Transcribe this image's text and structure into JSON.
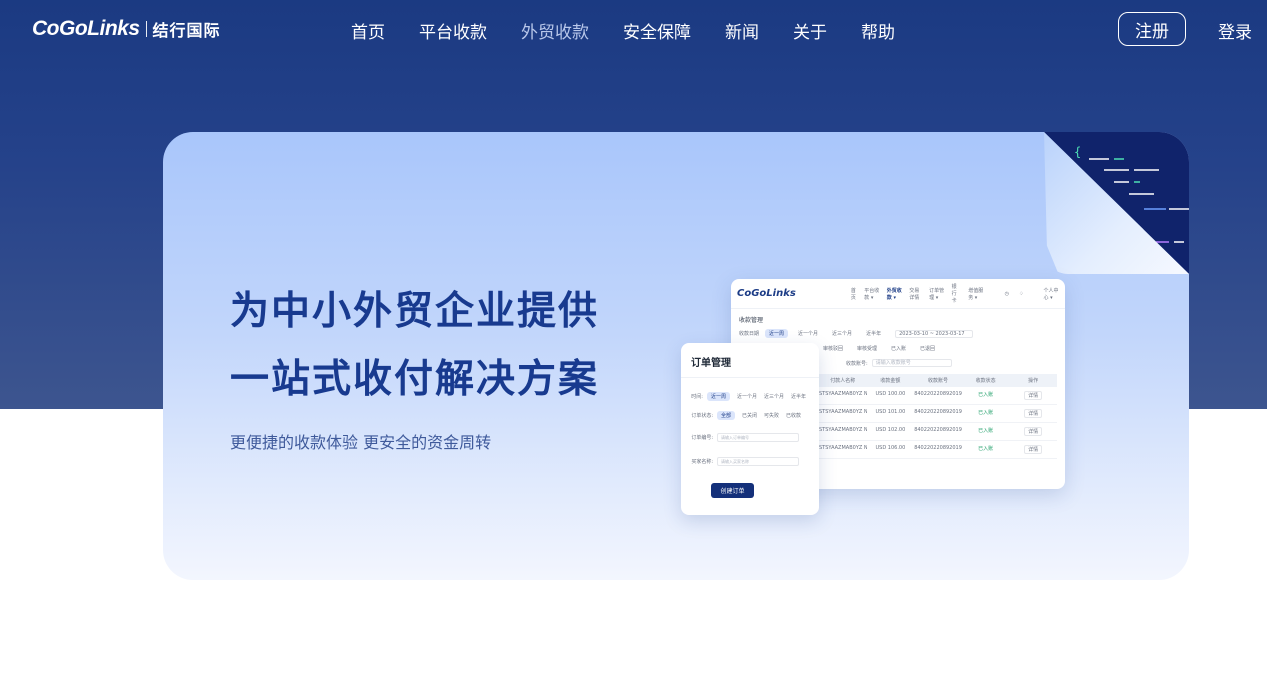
{
  "nav": {
    "logo_word": "CoGoLinks",
    "logo_cn": "结行国际",
    "items": [
      {
        "label": "首页"
      },
      {
        "label": "平台收款"
      },
      {
        "label": "外贸收款",
        "active": true
      },
      {
        "label": "安全保障"
      },
      {
        "label": "新闻"
      },
      {
        "label": "关于"
      },
      {
        "label": "帮助"
      }
    ],
    "register_label": "注册",
    "login_label": "登录"
  },
  "hero": {
    "title_line1": "为中小外贸企业提供",
    "title_line2": "一站式收付解决方案",
    "subtitle": "更便捷的收款体验 更安全的资金周转"
  },
  "dashboard_mock": {
    "logo": "CoGoLinks",
    "tabs": [
      "首页",
      "平台收款 ▾",
      "外贸收款 ▾",
      "交易详情",
      "订单管理 ▾",
      "银行卡",
      "增值服务 ▾"
    ],
    "active_tab_index": 2,
    "user": "个人中心 ▾",
    "page_title": "收款管理",
    "date_label": "收款日期",
    "date_chips": [
      "近一周",
      "近一个月",
      "近三个月",
      "近半年"
    ],
    "date_range": "2023-03-10 ~ 2023-03-17",
    "status_chips": [
      "审核驳回",
      "审核受理",
      "已入账",
      "已退回"
    ],
    "search_label": "收款账号:",
    "search_placeholder": "请输入收款账号",
    "columns": [
      "付款人名称",
      "收款金额",
      "收款账号",
      "收款状态",
      "操作"
    ],
    "rows": [
      {
        "payer": "STSYAAZMAB0YZ NAB",
        "amount": "USD 100.00",
        "account": "8402202208920191",
        "status": "已入账",
        "action": "详情"
      },
      {
        "payer": "STSYAAZMAB0YZ NAB",
        "amount": "USD 101.00",
        "account": "8402202208920191",
        "status": "已入账",
        "action": "详情"
      },
      {
        "payer": "STSYAAZMAB0YZ NAB",
        "amount": "USD 102.00",
        "account": "8402202208920191",
        "status": "已入账",
        "action": "详情"
      },
      {
        "payer": "STSYAAZMAB0YZ NAB",
        "amount": "USD 106.00",
        "account": "8402202208920191",
        "status": "已入账",
        "action": "详情"
      }
    ]
  },
  "order_card": {
    "title": "订单管理",
    "time_label": "时间:",
    "time_chips": [
      "近一周",
      "近一个月",
      "近三个月",
      "近半年"
    ],
    "status_label": "订单状态:",
    "status_chips": [
      "全部",
      "已关闭",
      "可失败",
      "已收款"
    ],
    "order_no_label": "订单编号:",
    "order_no_placeholder": "请输入订单编号",
    "customer_label": "买家名称:",
    "customer_placeholder": "请输入买家名称",
    "create_button": "创建订单"
  },
  "colors": {
    "nav_bg": "#1b3a82",
    "accent": "#183a8f",
    "button_dark": "#14307a",
    "status_green": "#22a06b"
  }
}
